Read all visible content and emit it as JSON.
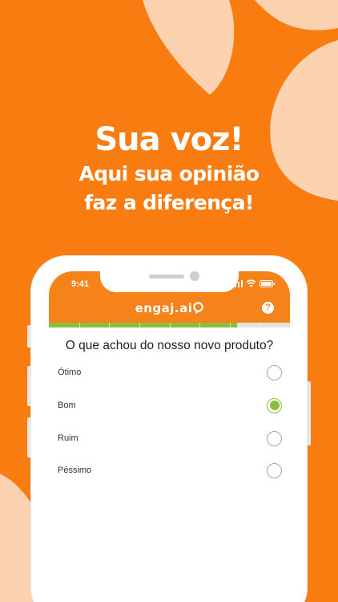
{
  "colors": {
    "background": "#f87c0f",
    "accent_shape": "#fcd2b0",
    "appbar": "#f5831a",
    "progress": "#8bbe3a"
  },
  "headline": {
    "line1": "Sua voz!",
    "line2": "Aqui sua opinião",
    "line3": "faz a diferença!"
  },
  "status_bar": {
    "time": "9:41",
    "icons": [
      "signal-icon",
      "wifi-icon",
      "battery-icon"
    ]
  },
  "app": {
    "logo_text": "engaj.ai",
    "help_icon": "question-icon",
    "help_symbol": "?"
  },
  "survey": {
    "progress": 0.78,
    "progress_segments": 8,
    "question": "O que achou do nosso novo produto?",
    "options": [
      {
        "label": "Ótimo",
        "selected": false
      },
      {
        "label": "Bom",
        "selected": true
      },
      {
        "label": "Ruim",
        "selected": false
      },
      {
        "label": "Péssimo",
        "selected": false
      }
    ]
  }
}
